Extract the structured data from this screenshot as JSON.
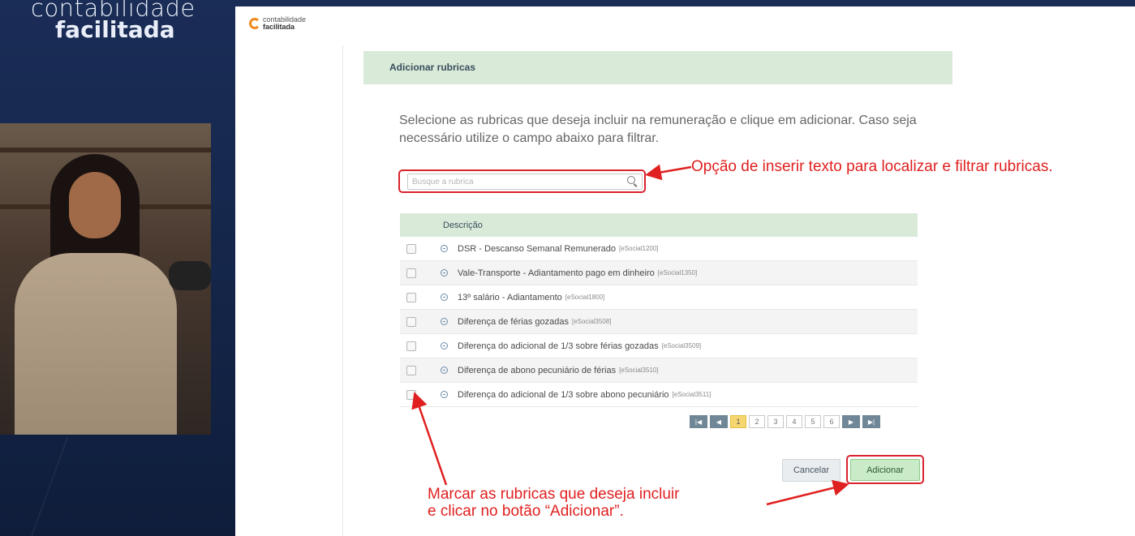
{
  "colors": {
    "side_panel": "#1a2d57",
    "header_band": "#d9ead9",
    "annotation_red": "#e02020",
    "add_button": "#c9ebc7",
    "pager_nav": "#6f8796",
    "pager_active": "#f6d66f"
  },
  "brand": {
    "line1": "contabilidade",
    "line2": "facilitada"
  },
  "app_logo": {
    "line1": "contabilidade",
    "line2": "facilitada"
  },
  "dialog": {
    "title": "Adicionar rubricas",
    "instructions": "Selecione as rubricas que deseja incluir na remuneração e clique em adicionar. Caso seja necessário utilize o campo abaixo para filtrar.",
    "search_placeholder": "Busque a rubrica",
    "table_header": "Descrição",
    "rows": [
      {
        "desc": "DSR - Descanso Semanal Remunerado",
        "code": "[eSocial1200]"
      },
      {
        "desc": "Vale-Transporte - Adiantamento pago em dinheiro",
        "code": "[eSocial1350]"
      },
      {
        "desc": "13º salário - Adiantamento",
        "code": "[eSocial1800]"
      },
      {
        "desc": "Diferença de férias gozadas",
        "code": "[eSocial3508]"
      },
      {
        "desc": "Diferença do adicional de 1/3 sobre férias gozadas",
        "code": "[eSocial3509]"
      },
      {
        "desc": "Diferença de abono pecuniário de férias",
        "code": "[eSocial3510]"
      },
      {
        "desc": "Diferença do adicional de 1/3 sobre abono pecuniário",
        "code": "[eSocial3511]"
      }
    ],
    "pages": [
      "1",
      "2",
      "3",
      "4",
      "5",
      "6"
    ],
    "active_page": "1",
    "cancel_label": "Cancelar",
    "add_label": "Adicionar"
  },
  "annotations": {
    "search_note": "Opção de inserir texto para localizar e filtrar rubricas.",
    "select_note_line1": "Marcar as rubricas que deseja incluir",
    "select_note_line2": "e clicar no botão “Adicionar”."
  }
}
